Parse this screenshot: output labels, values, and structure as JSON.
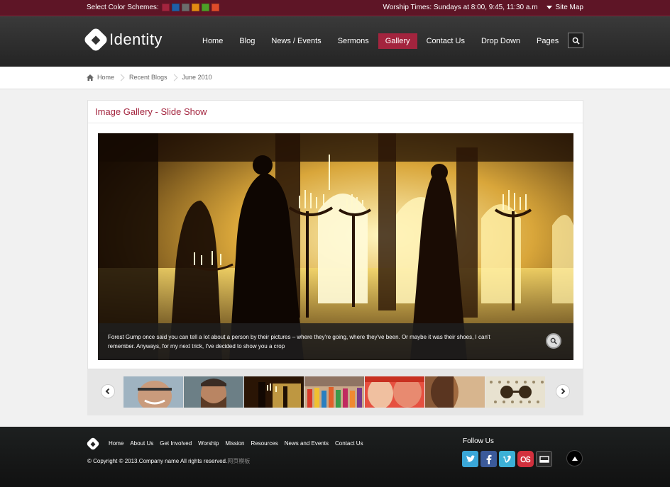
{
  "topbar": {
    "schemes_label": "Select Color Schemes:",
    "schemes": [
      "#a3243e",
      "#1f5fa6",
      "#6c6c6c",
      "#e38a12",
      "#4e9d27",
      "#e04b2a"
    ],
    "worship_times": "Worship Times: Sundays at 8:00, 9:45, 11:30 a.m",
    "sitemap_label": "Site Map"
  },
  "header": {
    "logo_text": "Identity",
    "nav": [
      "Home",
      "Blog",
      "News / Events",
      "Sermons",
      "Gallery",
      "Contact Us",
      "Drop Down",
      "Pages"
    ],
    "active_nav": "Gallery"
  },
  "breadcrumb": [
    "Home",
    "Recent Blogs",
    "June 2010"
  ],
  "gallery": {
    "title": "Image Gallery - Slide Show",
    "caption": "Forest Gump once said you can tell a lot about a person by their pictures – where they're going, where they've been. Or maybe it was their shoes, I can't remember. Anyways, for my next trick, I've decided to show you a crop",
    "thumbnail_count": 7
  },
  "footer": {
    "links": [
      "Home",
      "About Us",
      "Get Involved",
      "Worship",
      "Mission",
      "Resources",
      "News and Events",
      "Contact Us"
    ],
    "copyright": "© Copyright © 2013.Company name All rights reserved.",
    "copyright_extra": "网页模板",
    "follow_label": "Follow Us",
    "socials": [
      "twitter-icon",
      "facebook-icon",
      "vimeo-icon",
      "lastfm-icon",
      "delicious-icon"
    ]
  },
  "colors": {
    "accent": "#a3243e",
    "topbar": "#5e1526",
    "header": "#2e2e2e",
    "footer": "#161919"
  }
}
